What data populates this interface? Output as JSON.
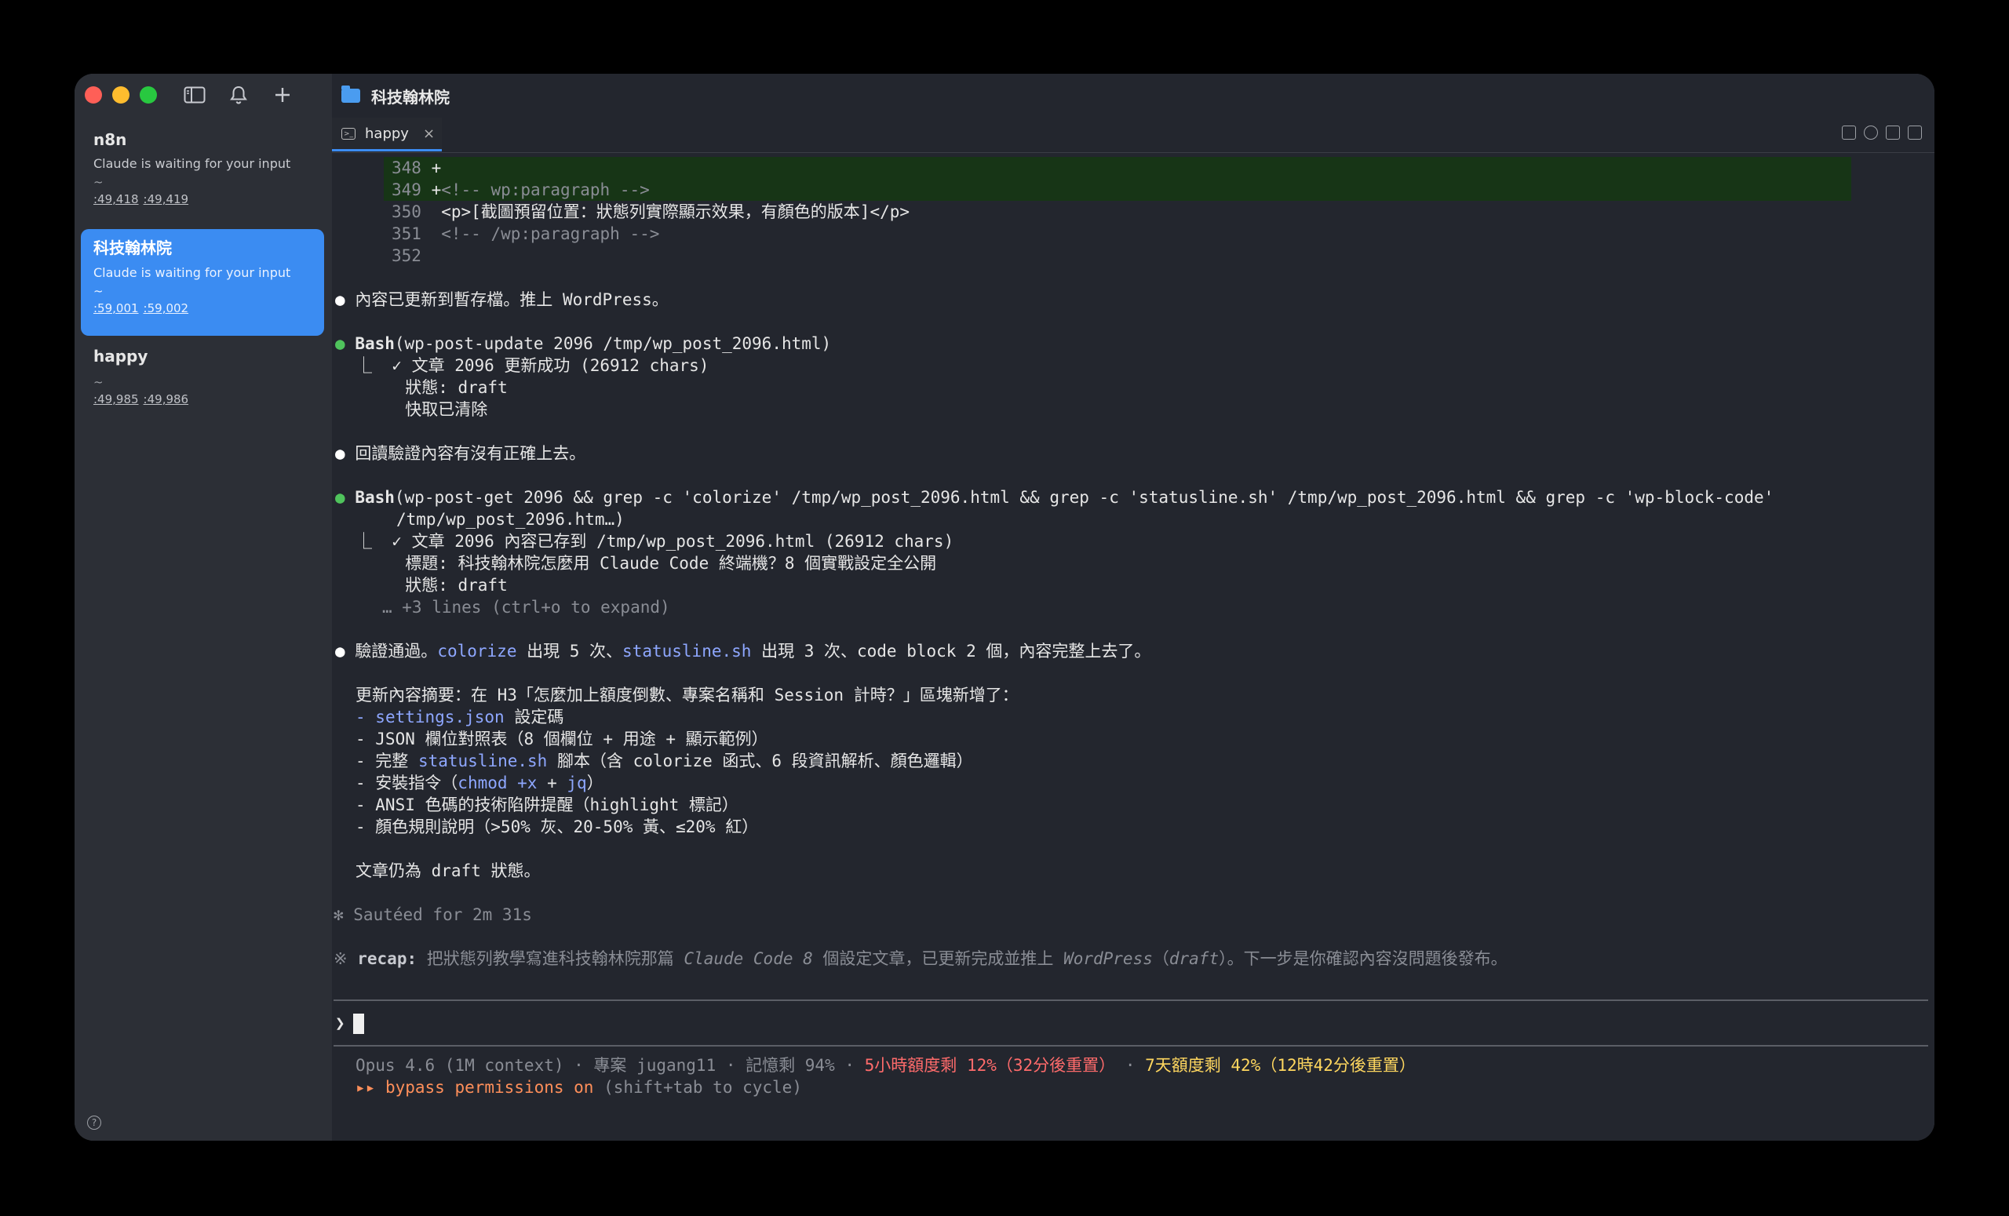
{
  "sidebar": {
    "sessions": [
      {
        "name": "n8n",
        "status": "Claude is waiting for your input",
        "cwd": "~",
        "port1": ":49,418",
        "port2": ":49,419"
      },
      {
        "name": "科技翰林院",
        "status": "Claude is waiting for your input",
        "cwd": "~",
        "port1": ":59,001",
        "port2": ":59,002"
      },
      {
        "name": "happy",
        "status": "",
        "cwd": "~",
        "port1": ":49,985",
        "port2": ":49,986"
      }
    ],
    "help": "?"
  },
  "header": {
    "title": "科技翰林院"
  },
  "tabs": [
    {
      "label": "happy",
      "close": "×"
    }
  ],
  "terminal": {
    "diff": [
      {
        "num": "348",
        "mark": "+",
        "text": ""
      },
      {
        "num": "349",
        "mark": "+",
        "text": "<!-- wp:paragraph -->"
      },
      {
        "num": "350",
        "mark": "",
        "text": "<p>[截圖預留位置：狀態列實際顯示效果，有顏色的版本]</p>"
      },
      {
        "num": "351",
        "mark": "",
        "text": "<!-- /wp:paragraph -->"
      },
      {
        "num": "352",
        "mark": "",
        "text": ""
      }
    ],
    "bullet": "●",
    "msg1": "內容已更新到暫存檔。推上 WordPress。",
    "bash1_name": "Bash",
    "bash1_cmd": "(wp-post-update 2096 /tmp/wp_post_2096.html)",
    "bash1_out": [
      "⎿  ✓ 文章 2096 更新成功 (26912 chars)",
      "     狀態: draft",
      "     快取已清除"
    ],
    "msg2": "回讀驗證內容有沒有正確上去。",
    "bash2_name": "Bash",
    "bash2_cmd": "(wp-post-get 2096 && grep -c 'colorize' /tmp/wp_post_2096.html && grep -c 'statusline.sh' /tmp/wp_post_2096.html && grep -c 'wp-block-code'",
    "bash2_cmd2": "/tmp/wp_post_2096.htm…)",
    "bash2_out": [
      "⎿  ✓ 文章 2096 內容已存到 /tmp/wp_post_2096.html (26912 chars)",
      "     標題: 科技翰林院怎麼用 Claude Code 終端機？8 個實戰設定全公開",
      "     狀態: draft"
    ],
    "bash2_more": "… +3 lines (ctrl+o to expand)",
    "msg3_a": "驗證通過。",
    "msg3_colorize": "colorize",
    "msg3_b": " 出現 5 次、",
    "msg3_statusline": "statusline.sh",
    "msg3_c": " 出現 3 次、code block 2 個，內容完整上去了。",
    "summary_head": "更新內容摘要：在 H3「怎麼加上額度倒數、專案名稱和 Session 計時？」區塊新增了：",
    "sum1_dash": "- ",
    "sum1_file": "settings.json",
    "sum1_rest": " 設定碼",
    "sum2": "- JSON 欄位對照表（8 個欄位 + 用途 + 顯示範例）",
    "sum3_a": "- 完整 ",
    "sum3_file": "statusline.sh",
    "sum3_b": " 腳本（含 colorize 函式、6 段資訊解析、顏色邏輯）",
    "sum4_a": "- 安裝指令（",
    "sum4_cmd1": "chmod +x",
    "sum4_plus": " + ",
    "sum4_cmd2": "jq",
    "sum4_b": "）",
    "sum5": "- ANSI 色碼的技術陷阱提醒（highlight 標記）",
    "sum6": "- 顏色規則說明（>50% 灰、20-50% 黃、≤20% 紅）",
    "still_draft": "文章仍為 draft 狀態。",
    "sauteed": "✻ Sautéed for 2m 31s",
    "recap_mark": "※ ",
    "recap_label": "recap:",
    "recap_a": " 把狀態列教學寫進科技翰林院那篇 ",
    "recap_i1": "Claude Code 8",
    "recap_b": " 個設定文章，已更新完成並推上 ",
    "recap_i2": "WordPress",
    "recap_c": "（",
    "recap_i3": "draft",
    "recap_d": "）。下一步是你確認內容沒問題後發布。",
    "prompt": "❯",
    "status_a": "Opus 4.6 (1M context) · 專案 jugang11 · 記憶剩 94% · ",
    "status_5h": "5小時額度剩 12%（32分後重置）",
    "status_dot": " · ",
    "status_7d": "7天額度剩 42%（12時42分後重置）",
    "bypass_arrows": "▸▸ ",
    "bypass_text": "bypass permissions on",
    "bypass_hint": " (shift+tab to cycle)"
  },
  "colors": {
    "accent": "#3b8cf2",
    "diff_add_bg": "#173516",
    "bullet_green": "#4fc35c",
    "link_blue": "#8ea7ff"
  }
}
